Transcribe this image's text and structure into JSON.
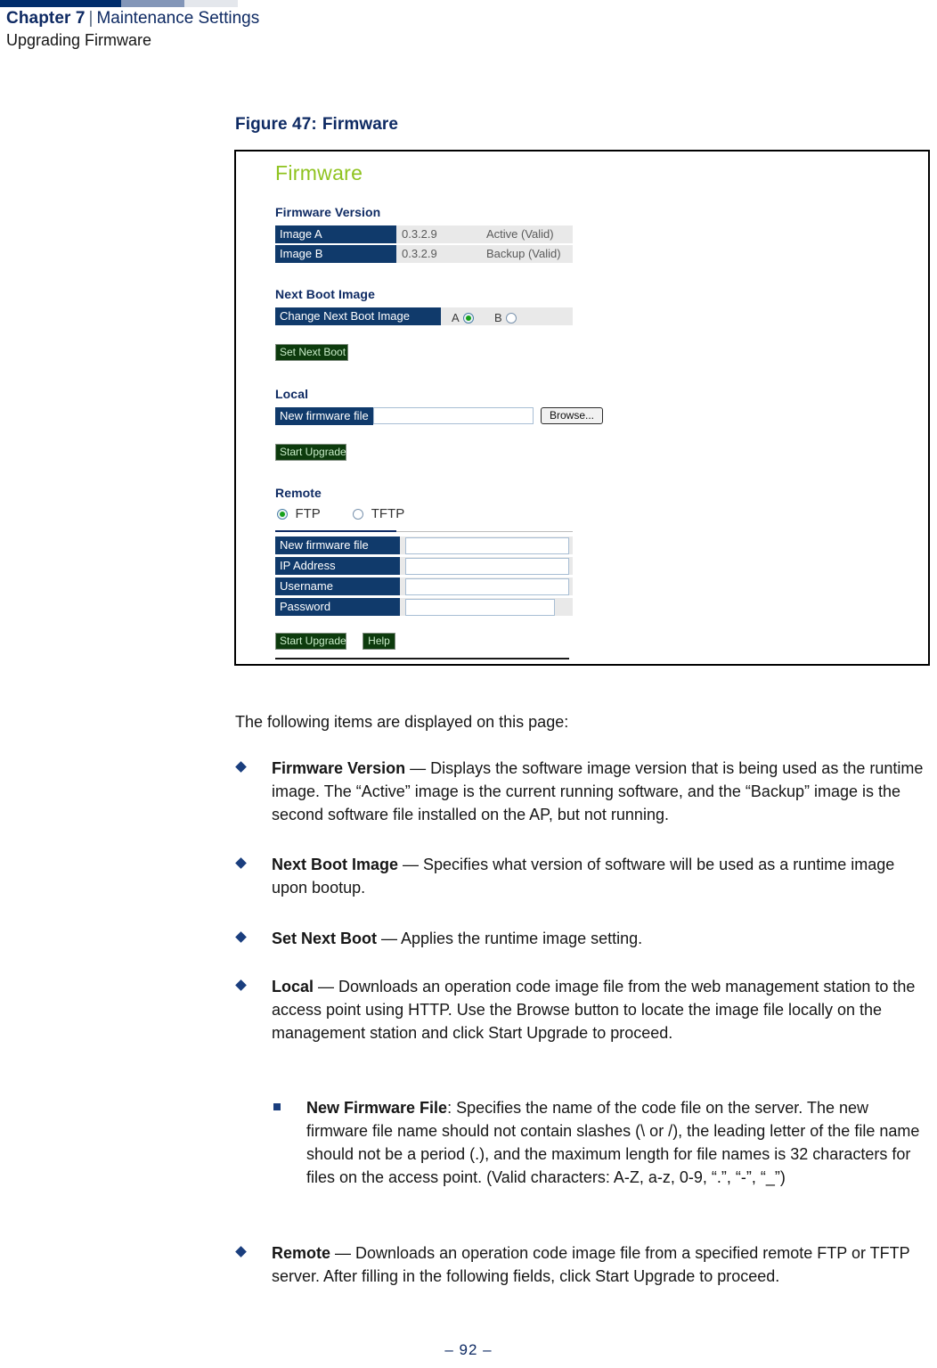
{
  "header": {
    "chapter": "Chapter 7",
    "separator": "|",
    "section": "Maintenance Settings",
    "subhead": "Upgrading Firmware"
  },
  "figure": {
    "caption_label": "Figure 47:",
    "caption_title": "Firmware"
  },
  "screenshot": {
    "title": "Firmware",
    "title_color": "#8fc31f",
    "sections": {
      "firmware_version": {
        "heading": "Firmware Version",
        "rows": [
          {
            "label": "Image A",
            "version": "0.3.2.9",
            "status": "Active (Valid)"
          },
          {
            "label": "Image B",
            "version": "0.3.2.9",
            "status": "Backup (Valid)"
          }
        ]
      },
      "next_boot_image": {
        "heading": "Next Boot Image",
        "row_label": "Change Next Boot Image",
        "option_a_label": "A",
        "option_a_selected": true,
        "option_b_label": "B",
        "option_b_selected": false,
        "button": "Set Next Boot"
      },
      "local": {
        "heading": "Local",
        "field_label": "New firmware file",
        "field_value": "",
        "browse_button": "Browse...",
        "upgrade_button": "Start Upgrade"
      },
      "remote": {
        "heading": "Remote",
        "protocol_ftp_label": "FTP",
        "protocol_ftp_selected": true,
        "protocol_tftp_label": "TFTP",
        "protocol_tftp_selected": false,
        "fields": [
          {
            "label": "New firmware file",
            "value": ""
          },
          {
            "label": "IP Address",
            "value": ""
          },
          {
            "label": "Username",
            "value": ""
          },
          {
            "label": "Password",
            "value": ""
          }
        ],
        "upgrade_button": "Start Upgrade",
        "help_button": "Help"
      }
    }
  },
  "body": {
    "intro": "The following items are displayed on this page:",
    "bullets": [
      {
        "term": "Firmware Version",
        "rest": " — Displays the software image version that is being used as the runtime image. The “Active” image is the current running software, and the “Backup” image is the second software file installed on the AP, but not running."
      },
      {
        "term": "Next Boot Image",
        "rest": " — Specifies what version of software will be used as a runtime image upon bootup."
      },
      {
        "term": "Set Next Boot",
        "rest": " — Applies the runtime image setting."
      },
      {
        "term": "Local",
        "rest": " — Downloads an operation code image file from the web management station to the access point using HTTP. Use the Browse button to locate the image file locally on the management station and click Start Upgrade to proceed."
      },
      {
        "term": "Remote",
        "rest": " — Downloads an operation code image file from a specified remote FTP or TFTP server. After filling in the following fields, click Start Upgrade to proceed."
      }
    ],
    "subbullet": {
      "term": "New Firmware File",
      "rest": ": Specifies the name of the code file on the server. The new firmware file name should not contain slashes (\\ or /), the leading letter of the file name should not be a period (.), and the maximum length for file names is 32 characters for files on the access point. (Valid characters: A-Z, a-z, 0-9, “.”, “-”, “_”)"
    }
  },
  "footer": {
    "page_number": "–  92  –"
  }
}
